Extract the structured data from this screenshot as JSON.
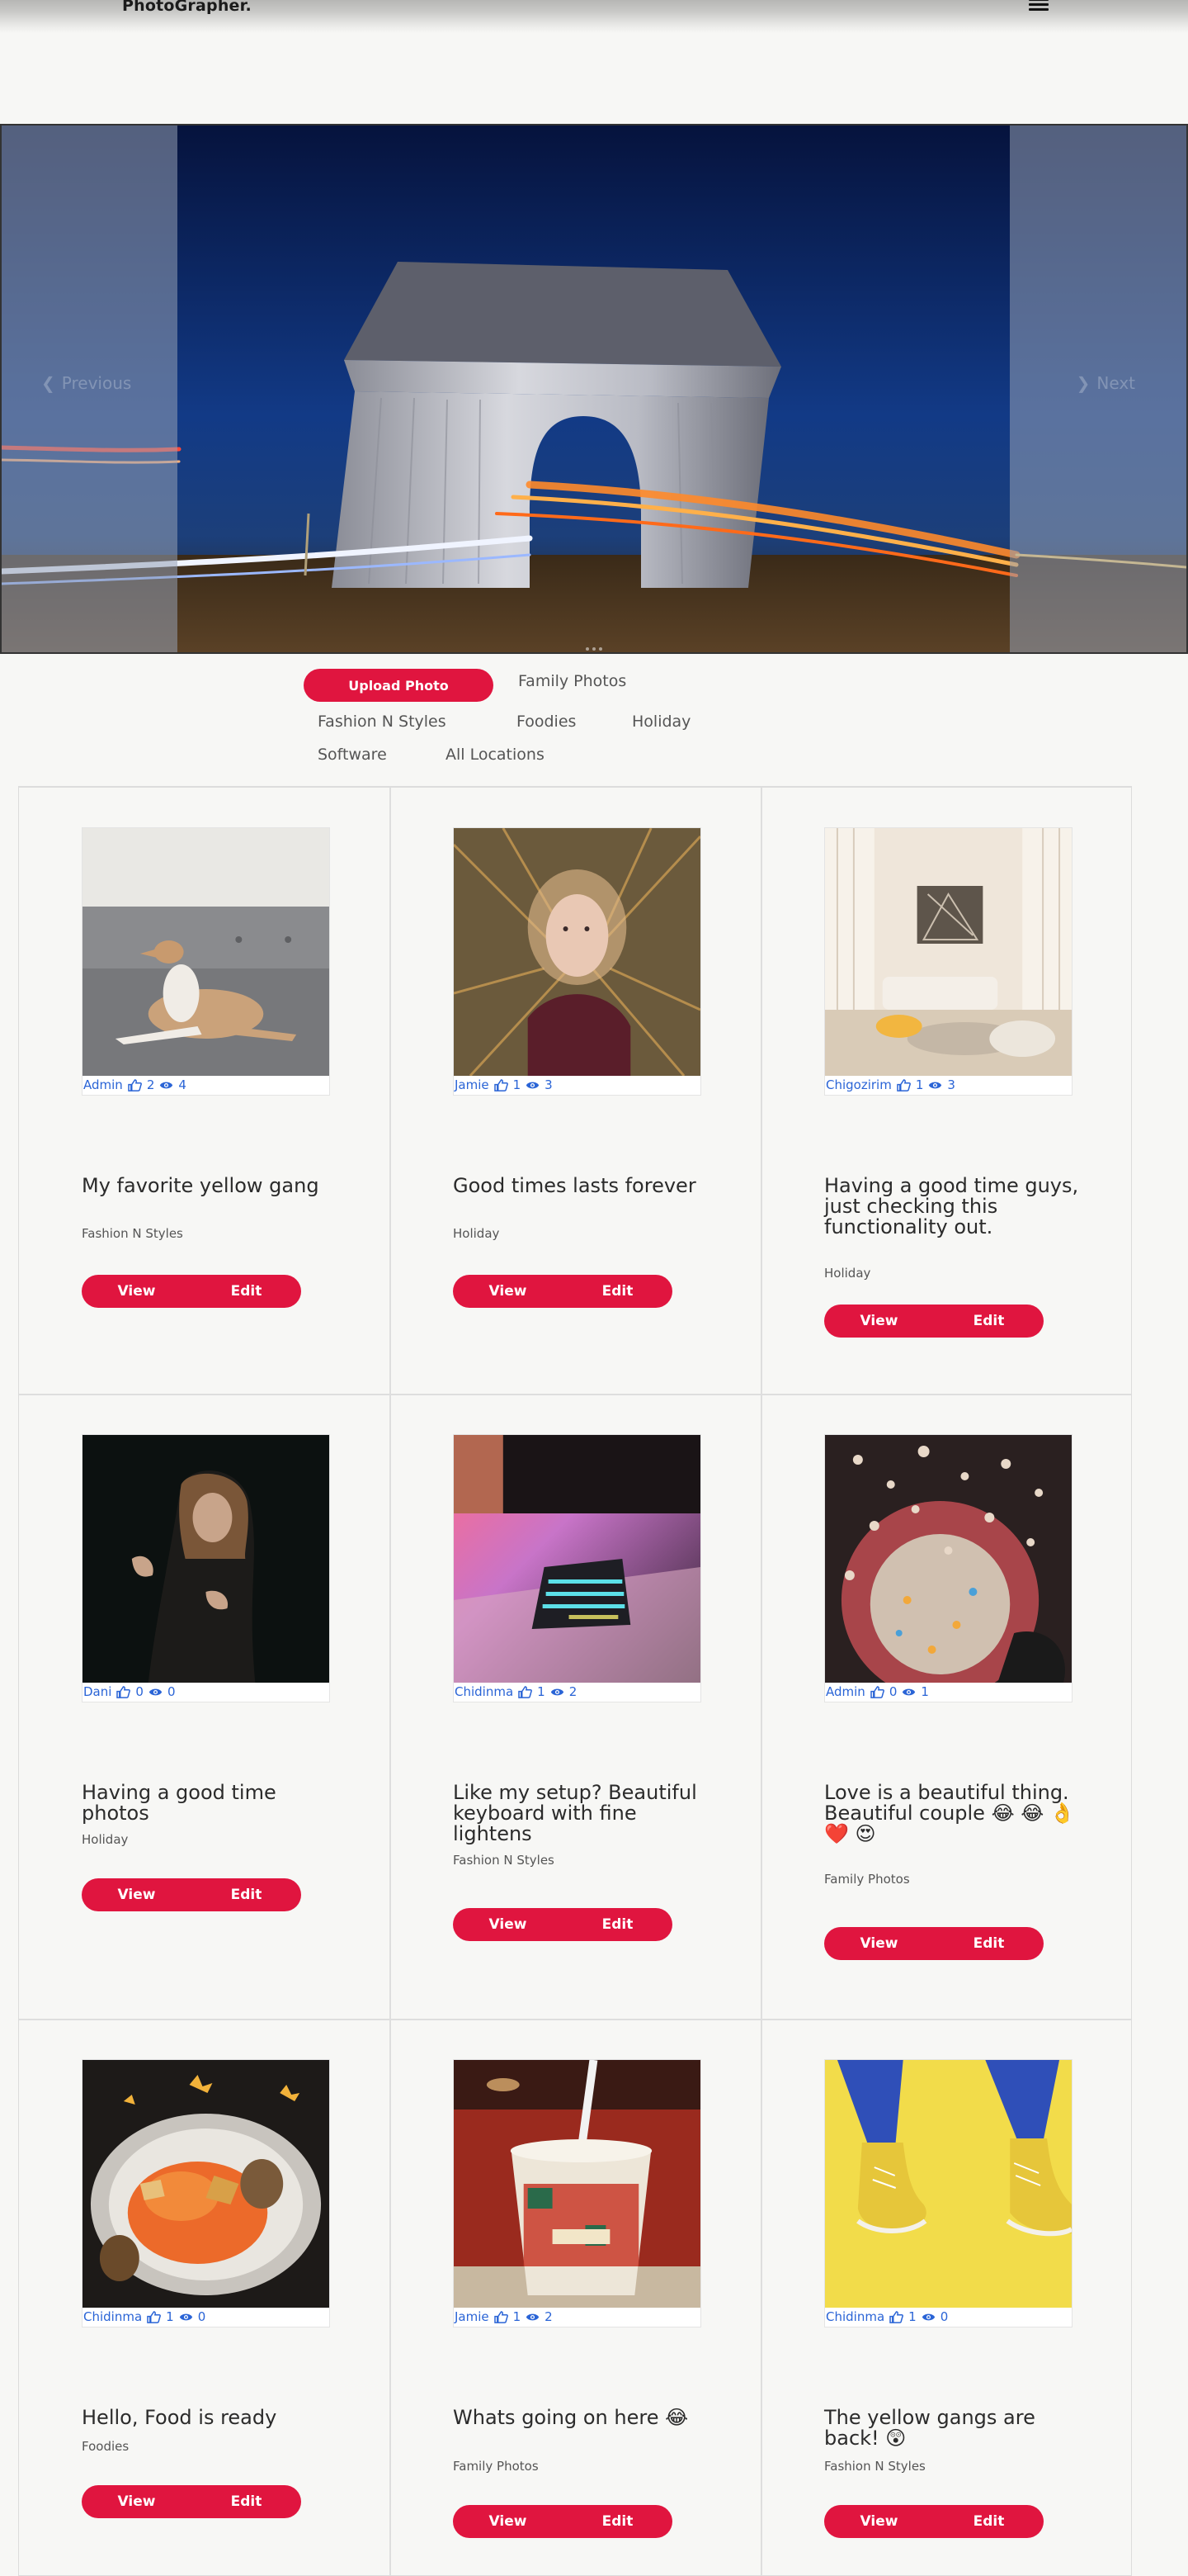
{
  "header": {
    "brand": "PhotoGrapher.",
    "menu_icon": "hamburger-icon"
  },
  "carousel": {
    "prev_label": "Previous",
    "next_label": "Next"
  },
  "filters": {
    "upload_label": "Upload Photo",
    "categories": [
      "Family Photos",
      "Fashion N Styles",
      "Foodies",
      "Holiday",
      "Software",
      "All Locations"
    ]
  },
  "colors": {
    "accent": "#e0153f",
    "link": "#2a64d6"
  },
  "cards": [
    {
      "author": "Admin",
      "likes": "2",
      "views": "4",
      "title": "My favorite yellow gang",
      "category": "Fashion N Styles",
      "view_label": "View",
      "edit_label": "Edit"
    },
    {
      "author": "Jamie",
      "likes": "1",
      "views": "3",
      "title": "Good times lasts forever",
      "category": "Holiday",
      "view_label": "View",
      "edit_label": "Edit"
    },
    {
      "author": "Chigozirim",
      "likes": "1",
      "views": "3",
      "title": "Having a good time guys, just checking this functionality out.",
      "category": "Holiday",
      "view_label": "View",
      "edit_label": "Edit"
    },
    {
      "author": "Dani",
      "likes": "0",
      "views": "0",
      "title": "Having a good time photos",
      "category": "Holiday",
      "view_label": "View",
      "edit_label": "Edit"
    },
    {
      "author": "Chidinma",
      "likes": "1",
      "views": "2",
      "title": "Like my setup? Beautiful keyboard with fine lightens",
      "category": "Fashion N Styles",
      "view_label": "View",
      "edit_label": "Edit"
    },
    {
      "author": "Admin",
      "likes": "0",
      "views": "1",
      "title": "Love is a beautiful thing. Beautiful couple 😂 😂 👌 ❤️ 😍",
      "category": "Family Photos",
      "view_label": "View",
      "edit_label": "Edit"
    },
    {
      "author": "Chidinma",
      "likes": "1",
      "views": "0",
      "title": "Hello, Food is ready",
      "category": "Foodies",
      "view_label": "View",
      "edit_label": "Edit"
    },
    {
      "author": "Jamie",
      "likes": "1",
      "views": "2",
      "title": "Whats going on here 😂",
      "category": "Family Photos",
      "view_label": "View",
      "edit_label": "Edit"
    },
    {
      "author": "Chidinma",
      "likes": "1",
      "views": "0",
      "title": "The yellow gangs are back! 😲",
      "category": "Fashion N Styles",
      "view_label": "View",
      "edit_label": "Edit"
    }
  ]
}
